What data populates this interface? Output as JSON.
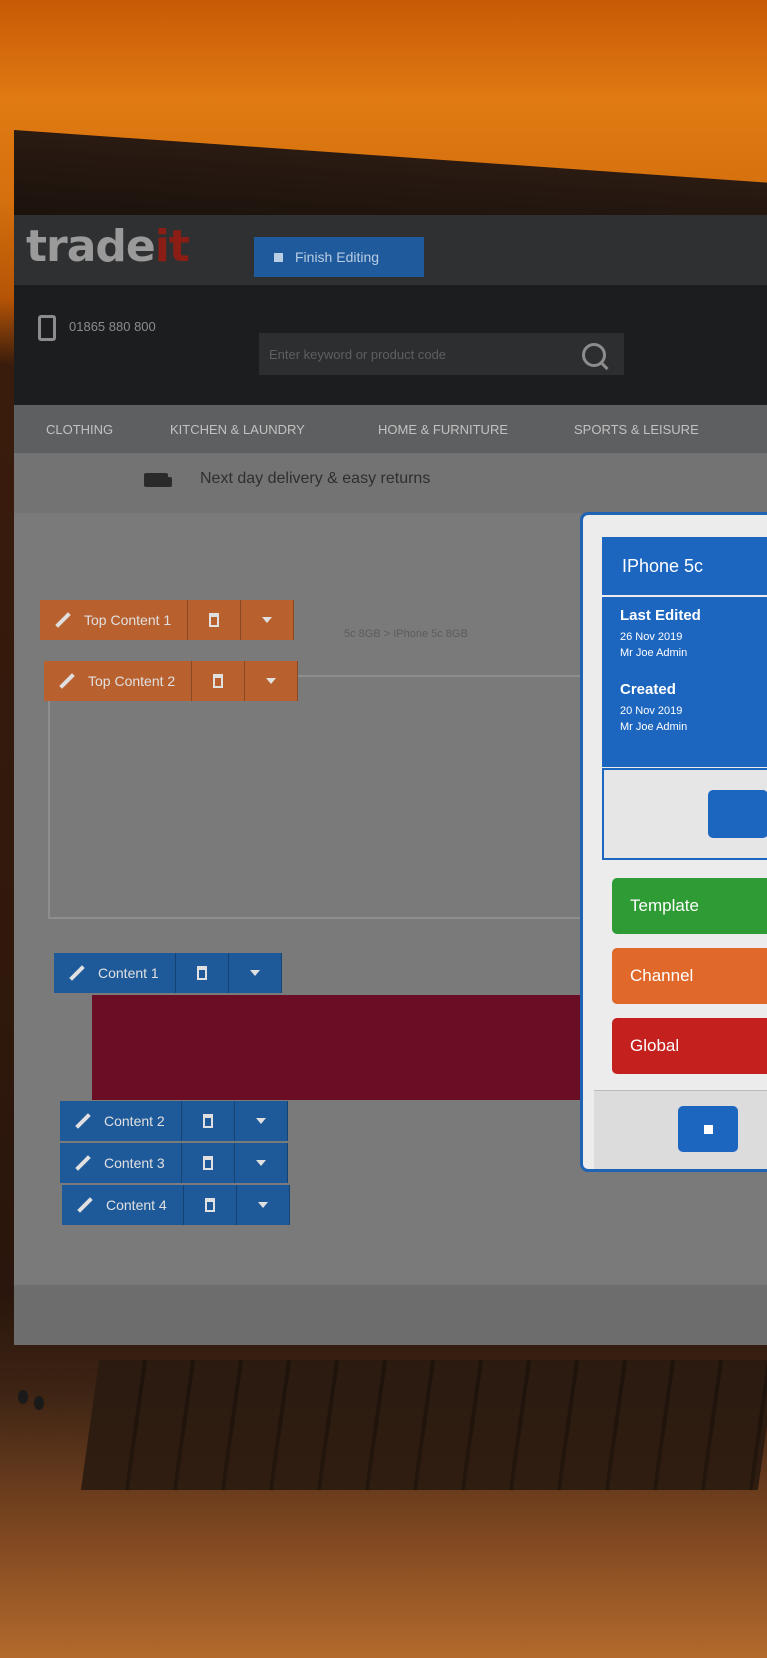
{
  "brand": {
    "logo_main": "trade",
    "logo_accent": "it"
  },
  "toolbar": {
    "finish_editing_label": "Finish Editing"
  },
  "header": {
    "phone": "01865 880 800",
    "search_placeholder": "Enter keyword or product code"
  },
  "nav": {
    "items": [
      "CLOTHING",
      "KITCHEN & LAUNDRY",
      "HOME & FURNITURE",
      "SPORTS & LEISURE"
    ]
  },
  "banner": {
    "delivery_text": "Next day delivery & easy returns"
  },
  "breadcrumb": "5c 8GB > IPhone 5c 8GB",
  "content_blocks": [
    {
      "label": "Top Content 1"
    },
    {
      "label": "Top Content 2"
    },
    {
      "label": "Content 1"
    },
    {
      "label": "Content 2"
    },
    {
      "label": "Content 3"
    },
    {
      "label": "Content 4"
    }
  ],
  "panel": {
    "title": "IPhone 5c",
    "last_edited_heading": "Last Edited",
    "last_edited_date": "26 Nov 2019",
    "last_edited_by": "Mr Joe Admin",
    "created_heading": "Created",
    "created_date": "20 Nov 2019",
    "created_by": "Mr Joe Admin",
    "scopes": [
      {
        "label": "Template",
        "color": "#2e9b35"
      },
      {
        "label": "Channel",
        "color": "#e0682a"
      },
      {
        "label": "Global",
        "color": "#c4201e"
      }
    ]
  },
  "colors": {
    "accent_blue": "#1d66c0",
    "edit_orange": "#b8612f",
    "edit_blue": "#1e5a9a",
    "brand_red": "#8a1e14"
  }
}
